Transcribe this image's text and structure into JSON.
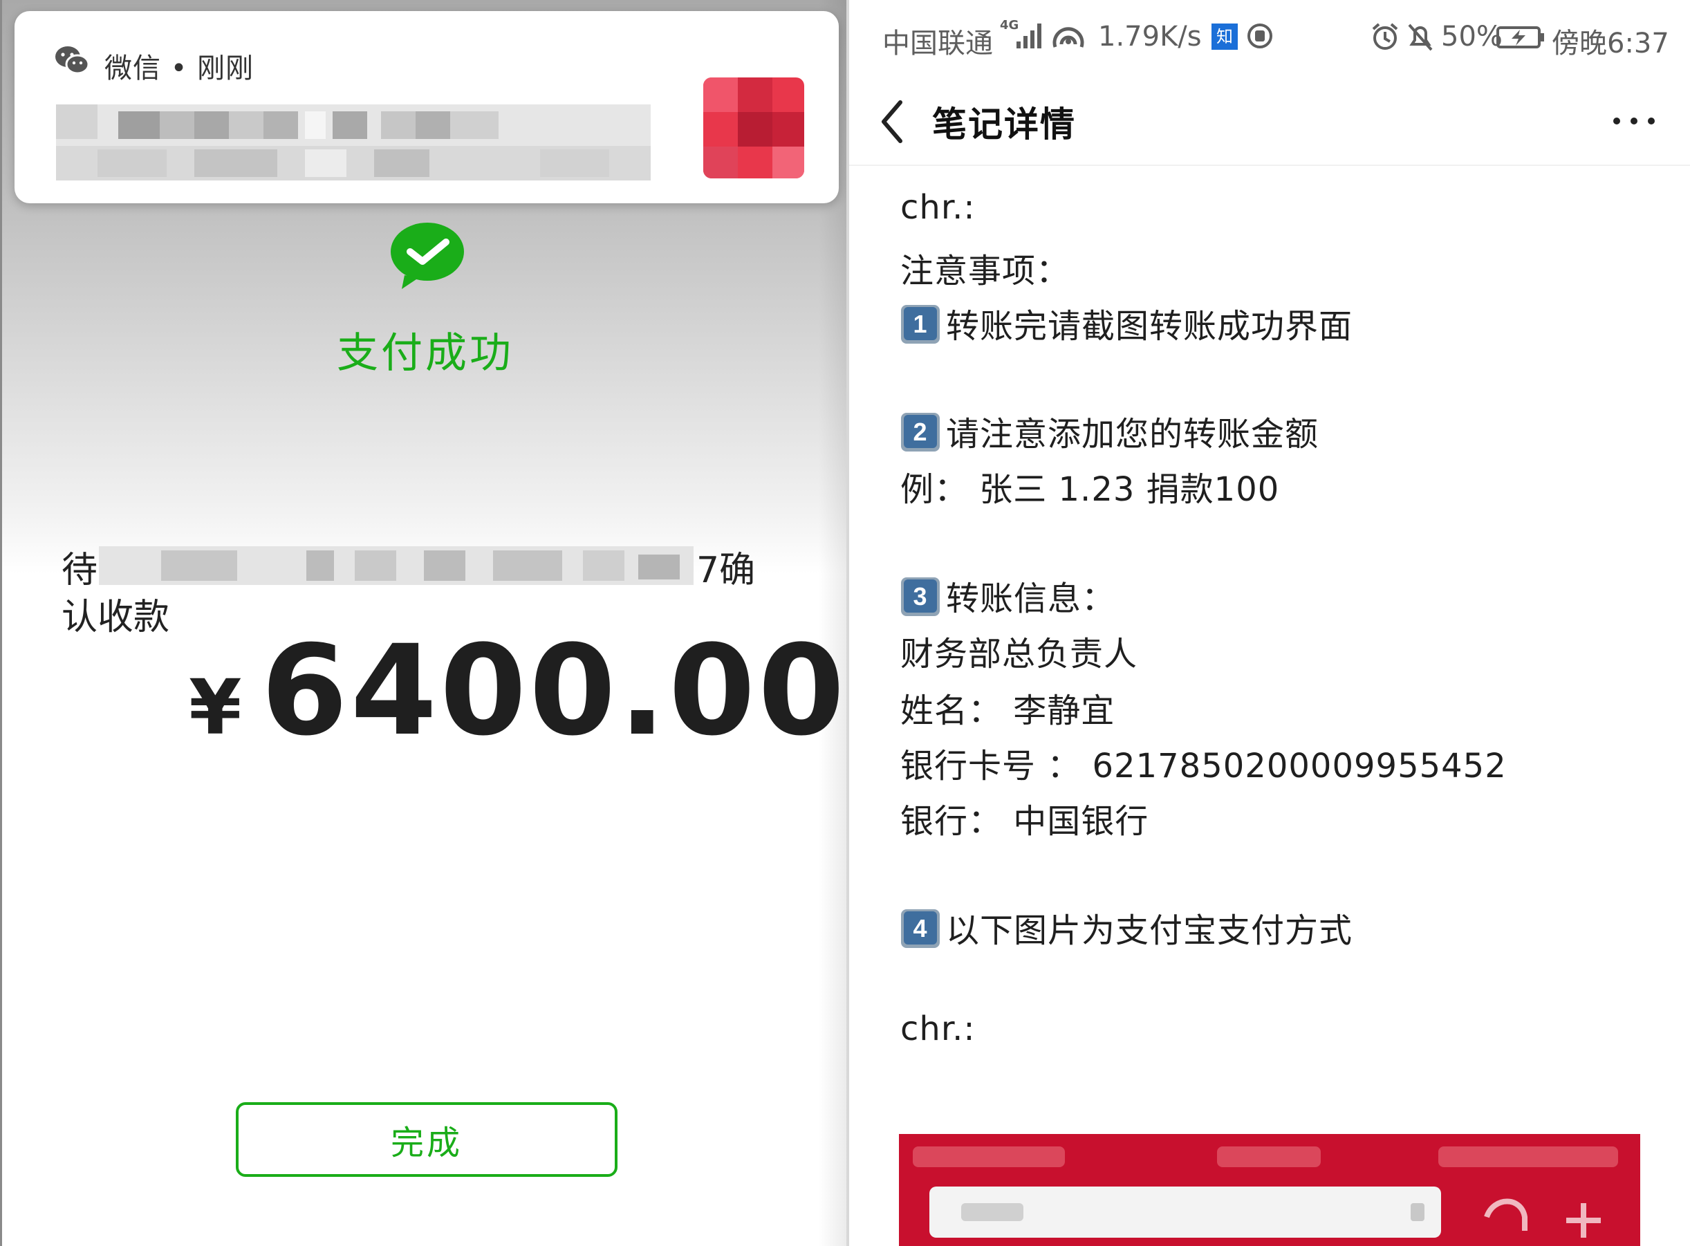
{
  "left": {
    "notification": {
      "app_label": "微信 • 刚刚"
    },
    "success_text": "支付成功",
    "confirm_prefix": "待",
    "confirm_suffix": "7确",
    "confirm_line2": "认收款",
    "currency": "¥",
    "amount": "6400.00",
    "done_label": "完成",
    "colors": {
      "wechat_green": "#1aad19"
    }
  },
  "right": {
    "status_bar": {
      "carrier": "中国联通",
      "network": "4G",
      "speed": "1.79K/s",
      "battery": "50%",
      "time": "傍晚6:37",
      "badge": "知"
    },
    "title": "笔记详情",
    "note_lines": [
      "chr.:",
      "注意事项：",
      "转账完请截图转账成功界面",
      "请注意添加您的转账金额",
      "例：  张三 1.23 捐款100",
      "转账信息：",
      "财务部总负责人",
      "姓名：  李静宜",
      "银行卡号 ：  6217850200009955452",
      "银行：  中国银行",
      "以下图片为支付宝支付方式",
      "chr.:"
    ],
    "keycap_numbers": [
      "1",
      "2",
      "3",
      "4"
    ]
  }
}
